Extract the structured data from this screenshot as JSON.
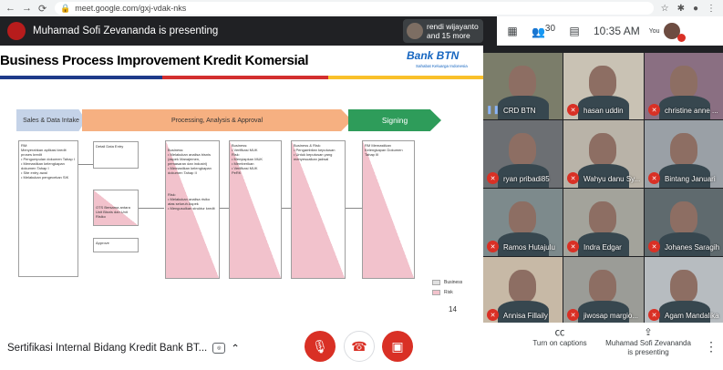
{
  "browser": {
    "url": "meet.google.com/gxj-vdak-nks",
    "lock_icon": "lock-icon",
    "nav_icons": [
      "back-arrow-icon",
      "forward-arrow-icon",
      "reload-icon"
    ],
    "ext_icons": [
      "star-icon",
      "extensions-icon",
      "profile-icon",
      "menu-dots-icon"
    ]
  },
  "meet_header": {
    "presenting_text": "Muhamad Sofi Zevananda is presenting",
    "others_text_line1": "rendi wijayanto",
    "others_text_line2": "and 15 more",
    "people_count": "30",
    "time": "10:35 AM",
    "you_label": "You"
  },
  "slide": {
    "title": "Business Process Improvement Kredit Komersial",
    "bank_logo": "Bank BTN",
    "bank_tagline": "Sahabat Keluarga Indonesia",
    "stage1": "Sales & Data Intake",
    "stage2": "Processing, Analysis & Approval",
    "stage3": "Signing",
    "box_rm": "RM:\nMenyerahkan aplikasi kredit\nproses kredit\n• Pengumpulan dokumen Tahap I\n• Memastikan kelengkapan dokumen Tahap I\n• Site entry awal\n• Melakukan pengecekan SIK",
    "box_detail": "Detail Data Entry",
    "box_ots": "OTS Bersama antara Unit Bisnis dan Unit Risiko",
    "box_approve": "Approve",
    "box_business1": "Business:\n• Melakukan analisa bisnis (aspek Manajemen, pemasaran dan industri)\n• Memastikan kelengkapan dokumen Tahap II",
    "box_risk1": "Risk:\n• Melakukan analisa risiko atas seluruh Aspek\n• Mengusulkan struktur kredit",
    "box_business2": "Business:\n• Verifikasi MUK\nRisk:\n• Menyiapkan MUK\n• Memberikan\n• Verifikasi MUK\nPeRK",
    "box_business3": "Business & Risk:\n• Pengambilan keputusan\n• Untuk keputusan yang menyesuaikan jadwal",
    "box_signing": "RM Memastikan Kelengkapan Dokumen Tahap III",
    "legend_business": "Business",
    "legend_risk": "Risk",
    "page_number": "14"
  },
  "participants": [
    {
      "name": "CRD BTN",
      "muted": false
    },
    {
      "name": "hasan uddin",
      "muted": true
    },
    {
      "name": "christine anne ...",
      "muted": true
    },
    {
      "name": "ryan pribadi85",
      "muted": true
    },
    {
      "name": "Wahyu danu Sy...",
      "muted": true
    },
    {
      "name": "Bintang Januari",
      "muted": true
    },
    {
      "name": "Ramos Hutajulu",
      "muted": true
    },
    {
      "name": "Indra Edgar",
      "muted": true
    },
    {
      "name": "Johanes Saragih",
      "muted": true
    },
    {
      "name": "Annisa Fillaily",
      "muted": true
    },
    {
      "name": "jiwosap margio...",
      "muted": true
    },
    {
      "name": "Agam Mandalika",
      "muted": true
    }
  ],
  "bottom": {
    "meeting_name": "Sertifikasi Internal Bidang Kredit Bank BT...",
    "captions_label": "Turn on captions",
    "presenting_label_line1": "Muhamad Sofi Zevananda",
    "presenting_label_line2": "is presenting"
  },
  "colors": {
    "danger": "#d93025",
    "stage_intake": "#c5d3e8",
    "stage_process": "#f6b081",
    "stage_sign": "#2e9c5a",
    "risk_pink": "#f2c2cc"
  }
}
